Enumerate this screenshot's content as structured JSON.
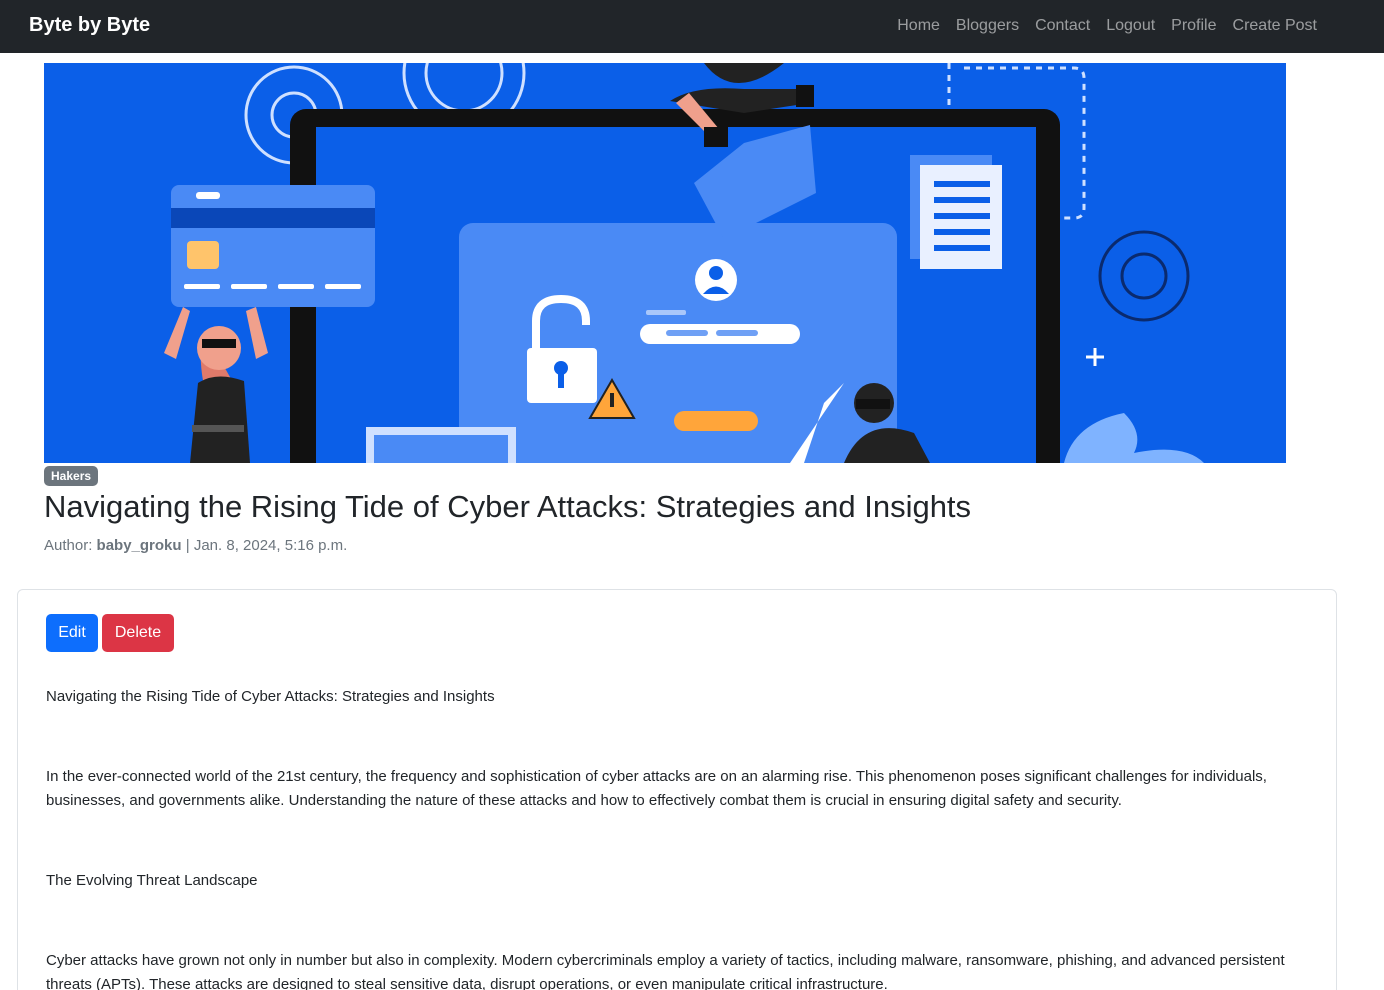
{
  "navbar": {
    "brand": "Byte by Byte",
    "links": [
      "Home",
      "Bloggers",
      "Contact",
      "Logout",
      "Profile",
      "Create Post"
    ]
  },
  "post": {
    "category": "Hakers",
    "title": "Navigating the Rising Tide of Cyber Attacks: Strategies and Insights",
    "author_label": "Author:",
    "author": "baby_groku",
    "separator": "|",
    "date": "Jan. 8, 2024, 5:16 p.m.",
    "actions": {
      "edit_label": "Edit",
      "delete_label": "Delete"
    },
    "paragraphs": [
      "Navigating the Rising Tide of Cyber Attacks: Strategies and Insights",
      "In the ever-connected world of the 21st century, the frequency and sophistication of cyber attacks are on an alarming rise. This phenomenon poses significant challenges for individuals, businesses, and governments alike. Understanding the nature of these attacks and how to effectively combat them is crucial in ensuring digital safety and security.",
      "The Evolving Threat Landscape",
      "Cyber attacks have grown not only in number but also in complexity. Modern cybercriminals employ a variety of tactics, including malware, ransomware, phishing, and advanced persistent threats (APTs). These attacks are designed to steal sensitive data, disrupt operations, or even manipulate critical infrastructure."
    ]
  },
  "colors": {
    "navbar_bg": "#212529",
    "hero_bg": "#0b5fe8",
    "edit_button": "#0d6efd",
    "delete_button": "#dc3545",
    "badge": "#6c757d"
  }
}
